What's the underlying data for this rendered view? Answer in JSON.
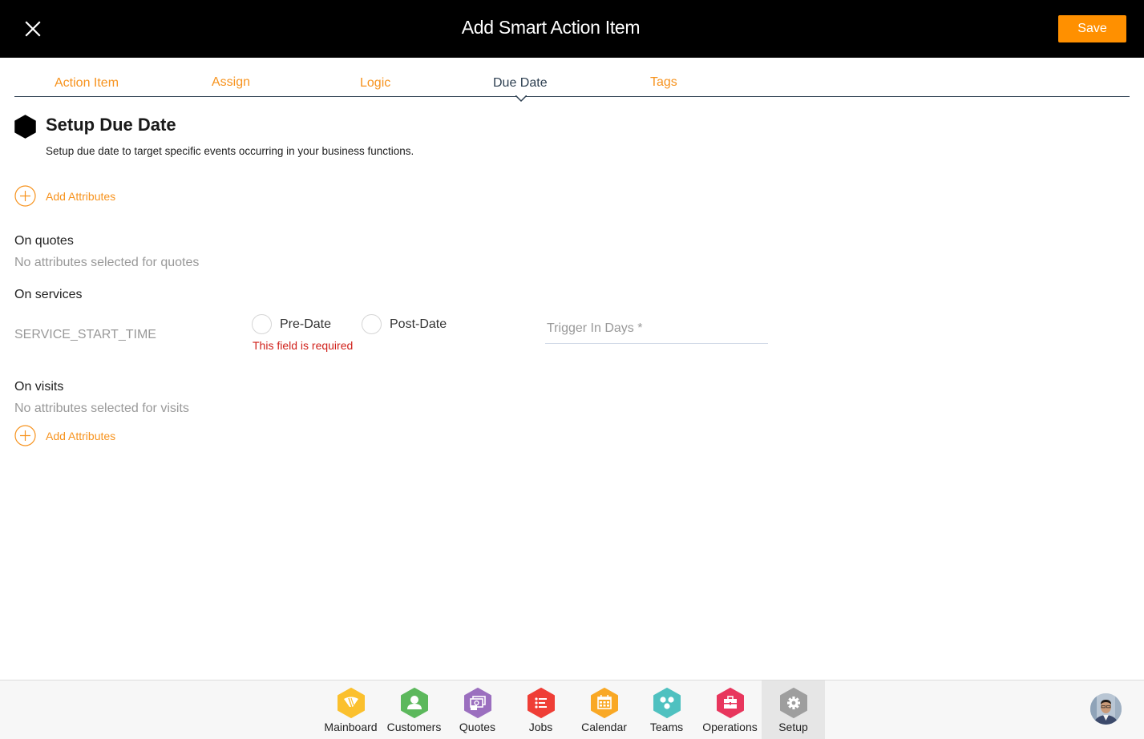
{
  "header": {
    "title": "Add Smart Action Item",
    "close_icon": "close-icon",
    "save_label": "Save",
    "save_color": "#ff9000"
  },
  "tabs": [
    {
      "label": "Action Item",
      "active": false
    },
    {
      "label": "Assign",
      "active": false
    },
    {
      "label": "Logic",
      "active": false
    },
    {
      "label": "Due Date",
      "active": true
    },
    {
      "label": "Tags",
      "active": false
    }
  ],
  "section": {
    "icon": "hexagon-icon",
    "title": "Setup Due Date",
    "description": "Setup due date to target specific events occurring in your business functions."
  },
  "add_attributes_label": "Add Attributes",
  "groups": {
    "quotes": {
      "title": "On quotes",
      "empty_text": "No attributes selected for quotes"
    },
    "services": {
      "title": "On services",
      "attributes": [
        {
          "name": "SERVICE_START_TIME",
          "options": [
            {
              "label": "Pre-Date",
              "selected": false
            },
            {
              "label": "Post-Date",
              "selected": false
            }
          ],
          "error": "This field is required",
          "trigger_placeholder": "Trigger In Days *",
          "trigger_value": ""
        }
      ]
    },
    "visits": {
      "title": "On visits",
      "empty_text": "No attributes selected for visits"
    }
  },
  "bottom_nav": [
    {
      "label": "Mainboard",
      "icon": "mainboard-icon",
      "color": "#fbc02d",
      "active": false
    },
    {
      "label": "Customers",
      "icon": "customers-icon",
      "color": "#5cb85c",
      "active": false
    },
    {
      "label": "Quotes",
      "icon": "quotes-icon",
      "color": "#9b6fbf",
      "active": false
    },
    {
      "label": "Jobs",
      "icon": "jobs-icon",
      "color": "#ef3e36",
      "active": false
    },
    {
      "label": "Calendar",
      "icon": "calendar-icon",
      "color": "#f9a825",
      "active": false
    },
    {
      "label": "Teams",
      "icon": "teams-icon",
      "color": "#4fc1c0",
      "active": false
    },
    {
      "label": "Operations",
      "icon": "operations-icon",
      "color": "#e8365d",
      "active": false
    },
    {
      "label": "Setup",
      "icon": "setup-icon",
      "color": "#9e9e9e",
      "active": true
    }
  ],
  "colors": {
    "accent": "#f7931e",
    "active_tab": "#2c3e50",
    "error": "#d0201a",
    "muted": "#999999"
  }
}
